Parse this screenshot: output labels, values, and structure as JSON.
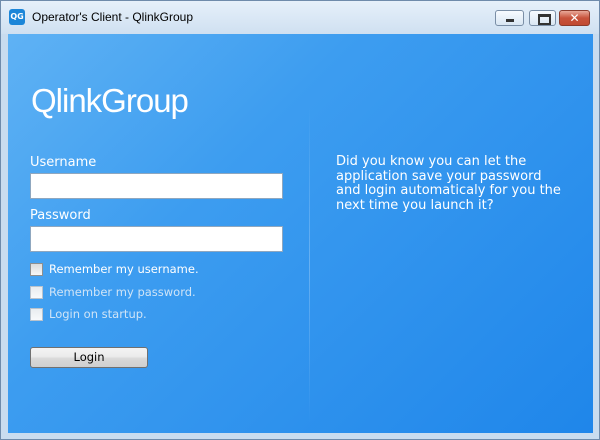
{
  "window": {
    "title": "Operator's Client - QlinkGroup",
    "icon": "qlinkgroup-app-icon",
    "icon_text": "QG",
    "close_glyph": "✕"
  },
  "brand": {
    "logo_text": "QlinkGroup"
  },
  "form": {
    "username_label": "Username",
    "username_value": "",
    "password_label": "Password",
    "password_value": "",
    "remember_username": {
      "label": "Remember my username.",
      "checked": false,
      "enabled": true
    },
    "remember_password": {
      "label": "Remember my password.",
      "checked": false,
      "enabled": false
    },
    "login_on_startup": {
      "label": "Login on startup.",
      "checked": false,
      "enabled": false
    },
    "login_button": "Login"
  },
  "tip": {
    "text": "Did you know you can let the application save your password and login automaticaly for you the next time you launch it?"
  },
  "colors": {
    "background_light": "#5fb2f4",
    "background_dark": "#1f86ea",
    "text": "#ffffff"
  }
}
